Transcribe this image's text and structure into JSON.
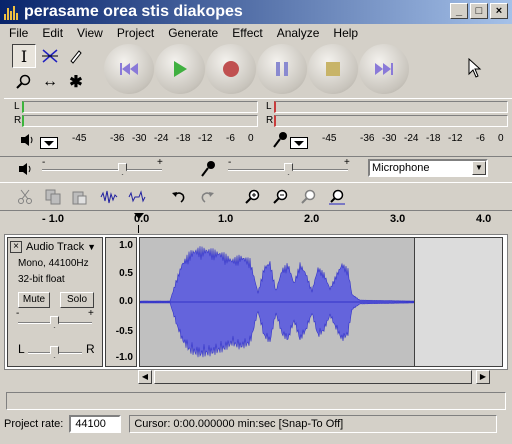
{
  "window": {
    "title": "perasame orea stis diakopes",
    "minimize_label": "_",
    "maximize_label": "□",
    "close_label": "×"
  },
  "menu": {
    "items": [
      "File",
      "Edit",
      "View",
      "Project",
      "Generate",
      "Effect",
      "Analyze",
      "Help"
    ]
  },
  "toolbox": {
    "tools": [
      "selection-tool-icon",
      "envelope-tool-icon",
      "draw-tool-icon",
      "zoom-tool-icon",
      "timeshift-tool-icon",
      "multi-tool-icon"
    ],
    "selection_glyph": "I",
    "timeshift_glyph": "↔",
    "multi_glyph": "✱"
  },
  "transport": {
    "buttons": [
      "skip-to-start",
      "play",
      "record",
      "pause",
      "stop",
      "skip-to-end"
    ]
  },
  "meters": {
    "left_label": "L",
    "right_label": "R",
    "ticks": [
      "-45",
      "-36",
      "-30",
      "-24",
      "-18",
      "-12",
      "-6",
      "0"
    ]
  },
  "mixer": {
    "output_plus": "+",
    "output_minus": "-",
    "input_plus": "+",
    "input_minus": "-",
    "input_source": "Microphone"
  },
  "ruler": {
    "labels": [
      "- 1.0",
      "0.0",
      "1.0",
      "2.0",
      "3.0",
      "4.0"
    ]
  },
  "track": {
    "name": "Audio Track",
    "close_label": "×",
    "format_line1": "Mono, 44100Hz",
    "format_line2": "32-bit float",
    "mute_label": "Mute",
    "solo_label": "Solo",
    "gain_minus": "-",
    "gain_plus": "+",
    "pan_left": "L",
    "pan_right": "R",
    "vruler": [
      "1.0",
      "0.5",
      "0.0",
      "-0.5",
      "-1.0"
    ],
    "wave_color": "#3232c8",
    "wave_fill": "#6464dc"
  },
  "status": {
    "project_rate_label": "Project rate:",
    "project_rate_value": "44100",
    "cursor_text": "Cursor: 0:00.000000 min:sec   [Snap-To Off]"
  }
}
